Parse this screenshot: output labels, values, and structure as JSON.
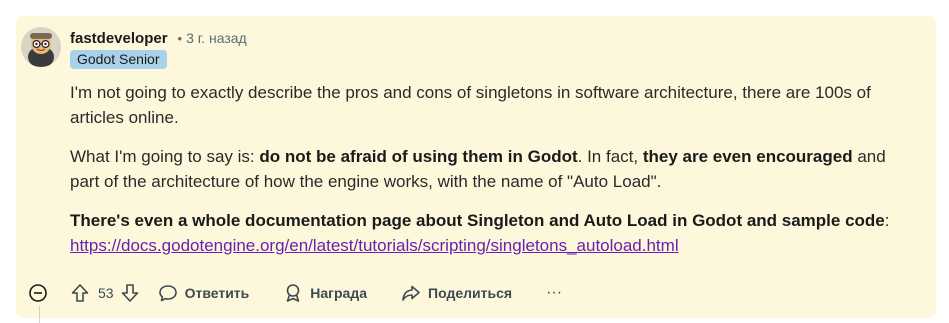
{
  "comment": {
    "username": "fastdeveloper",
    "separator": "•",
    "time": "3 г. назад",
    "flair": "Godot Senior",
    "para1": "I'm not going to exactly describe the pros and cons of singletons in software architecture, there are 100s of articles online.",
    "para2_a": "What I'm going to say is: ",
    "para2_b": "do not be afraid of using them in Godot",
    "para2_c": ". In fact, ",
    "para2_d": "they are even encouraged",
    "para2_e": " and part of the architecture of how the engine works, with the name of \"Auto Load\".",
    "para3_bold": "There's even a whole documentation page about Singleton and Auto Load in Godot and sample code",
    "para3_colon": ":",
    "link": "https://docs.godotengine.org/en/latest/tutorials/scripting/singletons_autoload.html"
  },
  "actions": {
    "vote_count": "53",
    "reply_label": "Ответить",
    "award_label": "Награда",
    "share_label": "Поделиться",
    "more_label": "···"
  },
  "icons": [
    "collapse-icon",
    "upvote-icon",
    "downvote-icon",
    "reply-icon",
    "award-icon",
    "share-icon",
    "more-icon"
  ]
}
